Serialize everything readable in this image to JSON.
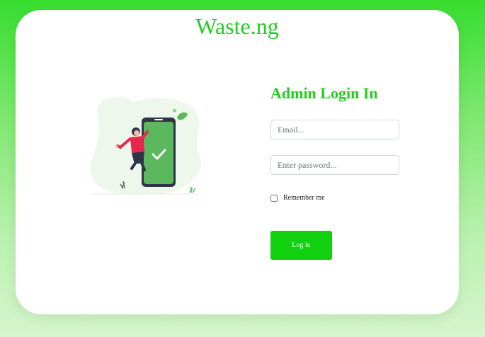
{
  "brand": {
    "name": "Waste.ng"
  },
  "login": {
    "title": "Admin Login In",
    "email_placeholder": "Email...",
    "password_placeholder": "Enter password...",
    "remember_label": "Remember me",
    "submit_label": "Log in"
  },
  "illustration": {
    "name": "mobile-login-success-illustration"
  },
  "colors": {
    "accent": "#1ecf1e",
    "button": "#10d010",
    "background_top": "#37dd2f",
    "background_bottom": "#d6f5cd"
  }
}
